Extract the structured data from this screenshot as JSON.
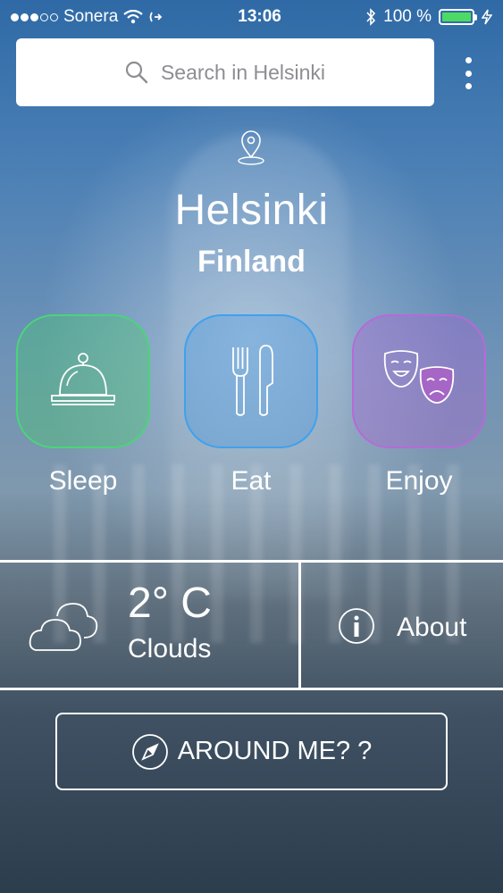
{
  "status_bar": {
    "carrier": "Sonera",
    "time": "13:06",
    "battery": "100 %",
    "battery_color": "#4cd964"
  },
  "search": {
    "placeholder": "Search in Helsinki"
  },
  "location": {
    "city": "Helsinki",
    "country": "Finland"
  },
  "categories": [
    {
      "label": "Sleep",
      "icon": "hotel-bell-icon",
      "color": "#4bd47a"
    },
    {
      "label": "Eat",
      "icon": "fork-knife-icon",
      "color": "#3fa1ee"
    },
    {
      "label": "Enjoy",
      "icon": "theater-masks-icon",
      "color": "#b66ad8"
    }
  ],
  "weather": {
    "temperature": "2° C",
    "condition": "Clouds",
    "icon": "clouds-icon"
  },
  "about": {
    "label": "About",
    "icon": "info-icon"
  },
  "around_me": {
    "label": "AROUND ME? ?",
    "icon": "compass-icon"
  }
}
